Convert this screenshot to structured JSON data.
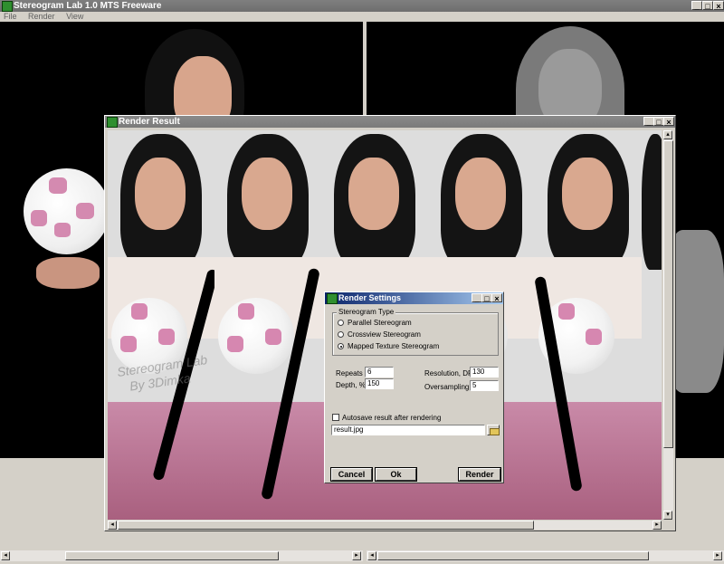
{
  "app": {
    "title": "Stereogram Lab 1.0 MTS Freeware",
    "menu": [
      "File",
      "Render",
      "View"
    ]
  },
  "render_result": {
    "title": "Render Result",
    "watermark_line1": "Stereogram Lab",
    "watermark_line2": "By 3Dimka"
  },
  "render_settings": {
    "title": "Render Settings",
    "group_label": "Stereogram Type",
    "options": [
      {
        "label": "Parallel Stereogram",
        "selected": false
      },
      {
        "label": "Crossview Stereogram",
        "selected": false
      },
      {
        "label": "Mapped Texture Stereogram",
        "selected": true
      }
    ],
    "repeats_label": "Repeats",
    "repeats_value": "6",
    "depth_label": "Depth, %",
    "depth_value": "150",
    "resolution_label": "Resolution, DPI",
    "resolution_value": "130",
    "oversampling_label": "Oversampling",
    "oversampling_value": "5",
    "autosave_label": "Autosave result after rendering",
    "autosave_checked": false,
    "filename_value": "result.jpg",
    "cancel_label": "Cancel",
    "ok_label": "Ok",
    "render_label": "Render"
  },
  "colors": {
    "dialog_title_start": "#0a246a",
    "dialog_title_end": "#a6caf0",
    "inactive_title": "#7a7a7a",
    "face": "#000000"
  }
}
